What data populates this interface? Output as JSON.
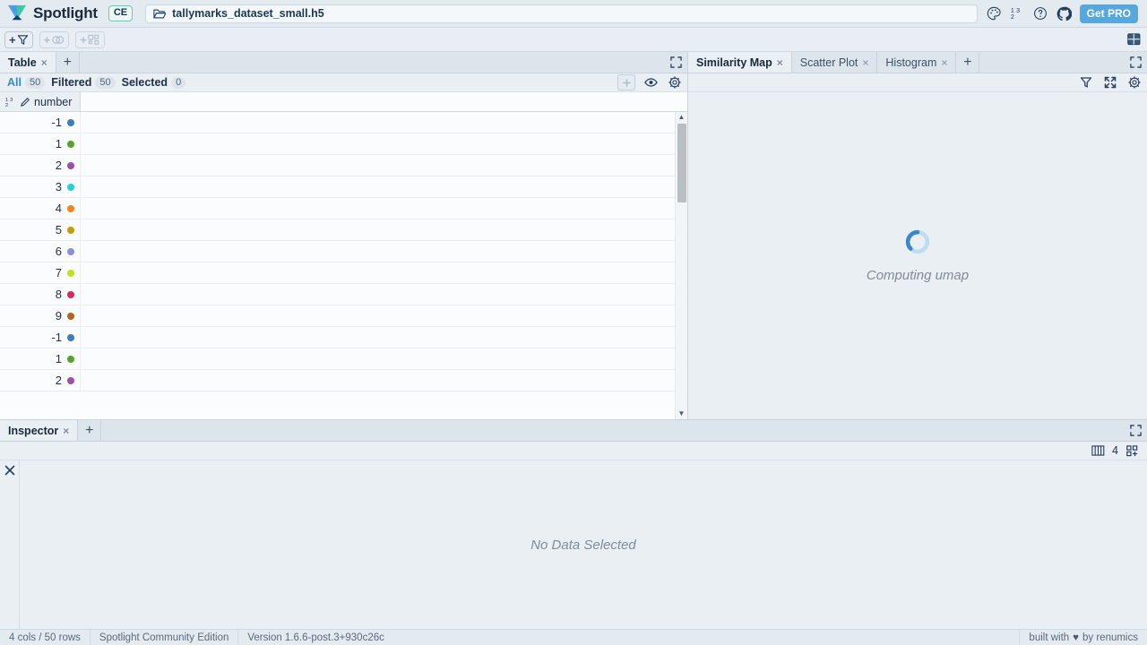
{
  "header": {
    "brand": "Spotlight",
    "edition_badge": "CE",
    "file_icon": "folder-open-icon",
    "file_name": "tallymarks_dataset_small.h5",
    "icons": [
      {
        "name": "palette-icon",
        "label": "Color palette"
      },
      {
        "name": "number-format-icon",
        "label": "Number format"
      },
      {
        "name": "help-circle-icon",
        "label": "Help"
      },
      {
        "name": "github-icon",
        "label": "GitHub"
      }
    ],
    "get_pro_label": "Get PRO"
  },
  "toolbar": {
    "add_filter_label": "+",
    "add_filter_icon": "funnel-icon",
    "add_group_icon": "circles-icon",
    "add_relation_icon": "graph-icon",
    "layout_icon": "layout-grid-icon"
  },
  "table_panel": {
    "tab_label": "Table",
    "tab_close": "×",
    "tab_add": "+",
    "expand_icon": "expand-icon",
    "status": {
      "all_label": "All",
      "all_count": "50",
      "filtered_label": "Filtered",
      "filtered_count": "50",
      "selected_label": "Selected",
      "selected_count": "0",
      "icons": [
        {
          "name": "add-column-icon"
        },
        {
          "name": "eye-icon"
        },
        {
          "name": "gear-icon"
        }
      ]
    },
    "column_header": {
      "format_icon": "number-format-icon",
      "edit_icon": "pencil-icon",
      "label": "number"
    },
    "rows": [
      {
        "value": "-1",
        "color": "#3b7fb5"
      },
      {
        "value": "1",
        "color": "#56a32a"
      },
      {
        "value": "2",
        "color": "#9b4fa8"
      },
      {
        "value": "3",
        "color": "#1fd2d8"
      },
      {
        "value": "4",
        "color": "#f5821f"
      },
      {
        "value": "5",
        "color": "#c79b06"
      },
      {
        "value": "6",
        "color": "#8b8fd4"
      },
      {
        "value": "7",
        "color": "#c2e019"
      },
      {
        "value": "8",
        "color": "#d62a5e"
      },
      {
        "value": "9",
        "color": "#b5611f"
      },
      {
        "value": "-1",
        "color": "#3b7fb5"
      },
      {
        "value": "1",
        "color": "#56a32a"
      },
      {
        "value": "2",
        "color": "#9b4fa8"
      }
    ],
    "scrollbar": {
      "up_arrow": "▲",
      "down_arrow": "▼"
    }
  },
  "viz_panel": {
    "tabs": [
      {
        "label": "Similarity Map",
        "active": true,
        "close": "×"
      },
      {
        "label": "Scatter Plot",
        "active": false,
        "close": "×"
      },
      {
        "label": "Histogram",
        "active": false,
        "close": "×"
      }
    ],
    "tab_add": "+",
    "expand_icon": "expand-icon",
    "toolbar_icons": [
      {
        "name": "funnel-icon"
      },
      {
        "name": "fullscreen-icon"
      },
      {
        "name": "gear-icon"
      }
    ],
    "loading_text": "Computing umap",
    "spinner_track_color": "#bcdcf0",
    "spinner_arc_color": "#3b88c9"
  },
  "inspector_panel": {
    "tab_label": "Inspector",
    "tab_close": "×",
    "tab_add": "+",
    "expand_icon": "expand-icon",
    "close_icon": "×",
    "columns_icon": "columns-icon",
    "columns_count": "4",
    "grid_add_icon": "grid-add-icon",
    "empty_text": "No Data Selected"
  },
  "statusbar": {
    "dims": "4 cols / 50 rows",
    "edition": "Spotlight Community Edition",
    "version": "Version 1.6.6-post.3+930c26c",
    "credit_prefix": "built with",
    "credit_heart": "♥",
    "credit_suffix": "by renumics"
  }
}
